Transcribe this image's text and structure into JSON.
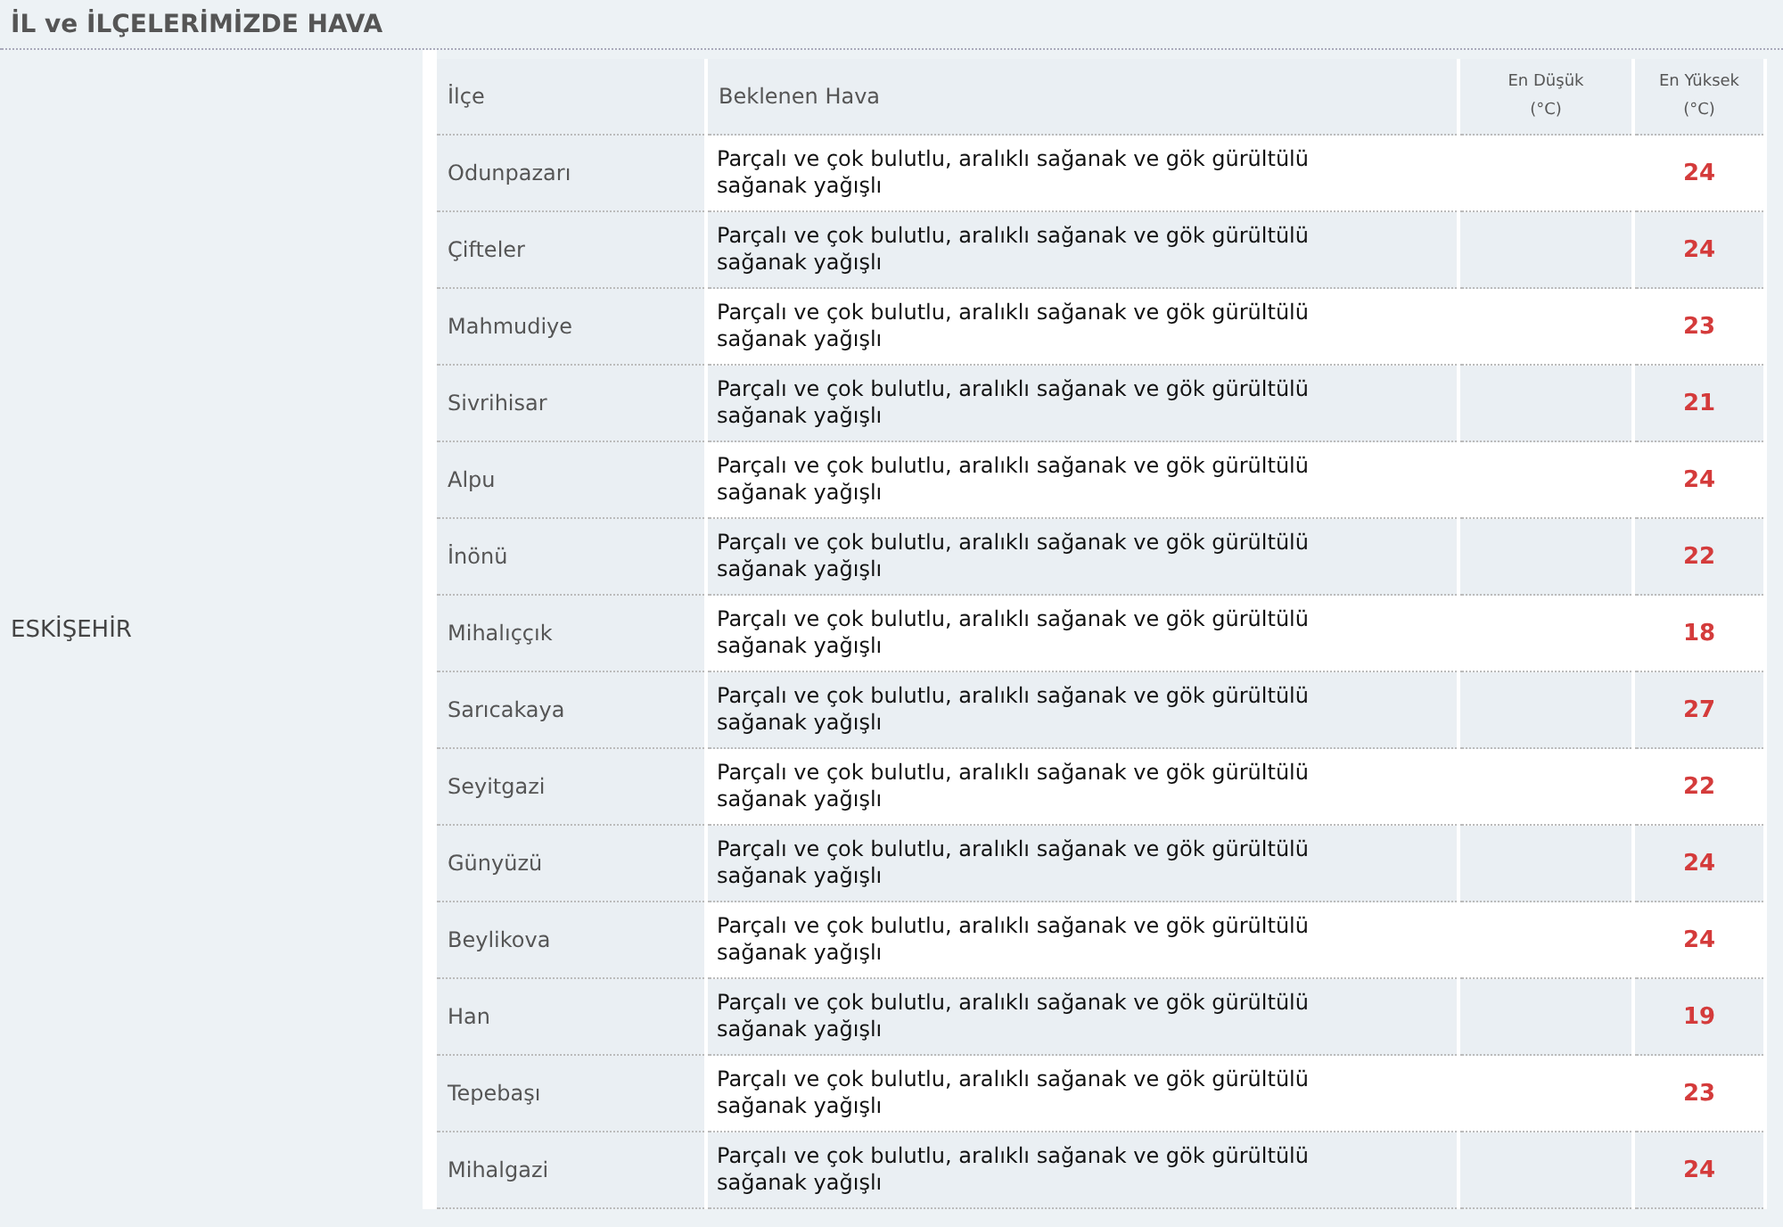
{
  "title": "İL ve İLÇELERİMİZDE HAVA",
  "province": "ESKİŞEHİR",
  "columns": [
    "İlçe",
    "Beklenen Hava",
    "En Düşük\n(°C)",
    "En Yüksek\n(°C)"
  ],
  "rows": [
    {
      "district": "Odunpazarı",
      "forecast": "Parçalı ve çok bulutlu, aralıklı sağanak ve gök gürültülü sağanak yağışlı",
      "high": "24"
    },
    {
      "district": "Çifteler",
      "forecast": "Parçalı ve çok bulutlu, aralıklı sağanak ve gök gürültülü sağanak yağışlı",
      "high": "24"
    },
    {
      "district": "Mahmudiye",
      "forecast": "Parçalı ve çok bulutlu, aralıklı sağanak ve gök gürültülü sağanak yağışlı",
      "high": "23"
    },
    {
      "district": "Sivrihisar",
      "forecast": "Parçalı ve çok bulutlu, aralıklı sağanak ve gök gürültülü sağanak yağışlı",
      "high": "21"
    },
    {
      "district": "Alpu",
      "forecast": "Parçalı ve çok bulutlu, aralıklı sağanak ve gök gürültülü sağanak yağışlı",
      "high": "24"
    },
    {
      "district": "İnönü",
      "forecast": "Parçalı ve çok bulutlu, aralıklı sağanak ve gök gürültülü sağanak yağışlı",
      "high": "22"
    },
    {
      "district": "Mihalıççık",
      "forecast": "Parçalı ve çok bulutlu, aralıklı sağanak ve gök gürültülü sağanak yağışlı",
      "high": "18"
    },
    {
      "district": "Sarıcakaya",
      "forecast": "Parçalı ve çok bulutlu, aralıklı sağanak ve gök gürültülü sağanak yağışlı",
      "high": "27"
    },
    {
      "district": "Seyitgazi",
      "forecast": "Parçalı ve çok bulutlu, aralıklı sağanak ve gök gürültülü sağanak yağışlı",
      "high": "22"
    },
    {
      "district": "Günyüzü",
      "forecast": "Parçalı ve çok bulutlu, aralıklı sağanak ve gök gürültülü sağanak yağışlı",
      "high": "24"
    },
    {
      "district": "Beylikova",
      "forecast": "Parçalı ve çok bulutlu, aralıklı sağanak ve gök gürültülü sağanak yağışlı",
      "high": "24"
    },
    {
      "district": "Han",
      "forecast": "Parçalı ve çok bulutlu, aralıklı sağanak ve gök gürültülü sağanak yağışlı",
      "high": "19"
    },
    {
      "district": "Tepebaşı",
      "forecast": "Parçalı ve çok bulutlu, aralıklı sağanak ve gök gürültülü sağanak yağışlı",
      "high": "23"
    },
    {
      "district": "Mihalgazi",
      "forecast": "Parçalı ve çok bulutlu, aralıklı sağanak ve gök gürültülü sağanak yağışlı",
      "high": "24"
    }
  ]
}
